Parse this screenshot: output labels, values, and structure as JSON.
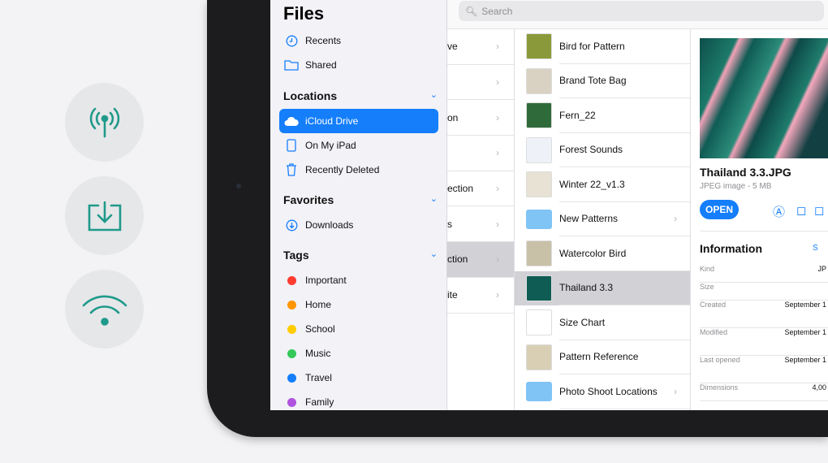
{
  "feature_icons": [
    "antenna-icon",
    "download-tray-icon",
    "wifi-icon"
  ],
  "search": {
    "placeholder": "Search"
  },
  "sidebar": {
    "title": "Files",
    "top": [
      {
        "label": "Recents",
        "icon": "clock-icon"
      },
      {
        "label": "Shared",
        "icon": "shared-folder-icon"
      }
    ],
    "locations_header": "Locations",
    "locations": [
      {
        "label": "iCloud Drive",
        "icon": "cloud-icon",
        "selected": true
      },
      {
        "label": "On My iPad",
        "icon": "ipad-icon"
      },
      {
        "label": "Recently Deleted",
        "icon": "trash-icon"
      }
    ],
    "favorites_header": "Favorites",
    "favorites": [
      {
        "label": "Downloads",
        "icon": "download-circle-icon"
      }
    ],
    "tags_header": "Tags",
    "tags": [
      {
        "label": "Important",
        "color": "#ff3b30"
      },
      {
        "label": "Home",
        "color": "#ff9500"
      },
      {
        "label": "School",
        "color": "#ffcc00"
      },
      {
        "label": "Music",
        "color": "#34c759"
      },
      {
        "label": "Travel",
        "color": "#147efb"
      },
      {
        "label": "Family",
        "color": "#af52de"
      }
    ]
  },
  "column2": [
    "ve",
    "",
    "on",
    "",
    "ection",
    "s",
    "ction",
    "ite"
  ],
  "column3": [
    {
      "label": "Bird for Pattern",
      "color": "#8a9a3a"
    },
    {
      "label": "Brand Tote Bag",
      "color": "#d9d2c2"
    },
    {
      "label": "Fern_22",
      "color": "#2f6b3a"
    },
    {
      "label": "Forest Sounds",
      "color": "#eef2f8"
    },
    {
      "label": "Winter 22_v1.3",
      "color": "#e8e2d4"
    },
    {
      "label": "New Patterns",
      "color": "#7fc4f5",
      "folder": true
    },
    {
      "label": "Watercolor Bird",
      "color": "#c9c0a8"
    },
    {
      "label": "Thailand 3.3",
      "color": "#0f5c55",
      "selected": true
    },
    {
      "label": "Size Chart",
      "color": "#ffffff"
    },
    {
      "label": "Pattern Reference",
      "color": "#d8cfb5"
    },
    {
      "label": "Photo Shoot Locations",
      "color": "#7fc4f5",
      "folder": true
    }
  ],
  "preview": {
    "filename": "Thailand 3.3.JPG",
    "meta": "JPEG image - 5 MB",
    "open": "OPEN",
    "info_header": "Information",
    "show_more": "S",
    "rows": [
      {
        "k": "Kind",
        "v": "JP"
      },
      {
        "k": "Size",
        "v": ""
      },
      {
        "k": "Created",
        "v": "September 1"
      },
      {
        "k": "Modified",
        "v": "September 1"
      },
      {
        "k": "Last opened",
        "v": "September 1"
      },
      {
        "k": "Dimensions",
        "v": "4,00"
      }
    ]
  }
}
